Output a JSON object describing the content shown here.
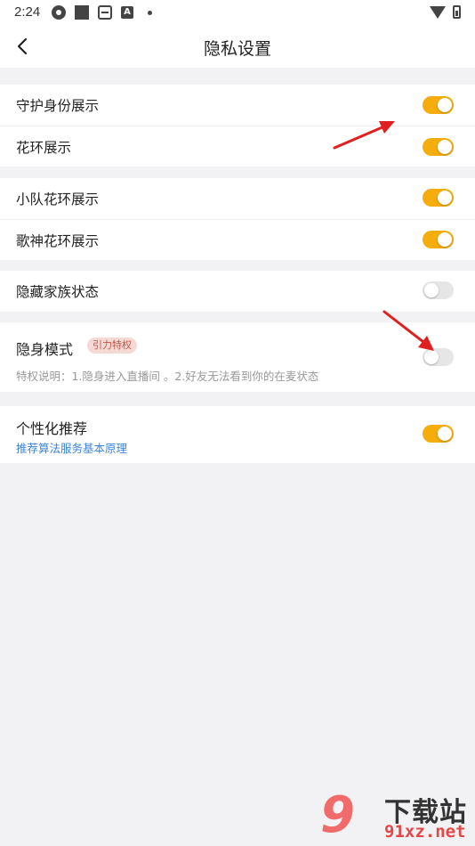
{
  "status_bar": {
    "time": "2:24"
  },
  "header": {
    "title": "隐私设置"
  },
  "groups": [
    {
      "items": [
        {
          "label": "守护身份展示",
          "enabled": true
        },
        {
          "label": "花环展示",
          "enabled": true
        }
      ]
    },
    {
      "items": [
        {
          "label": "小队花环展示",
          "enabled": true
        },
        {
          "label": "歌神花环展示",
          "enabled": true
        }
      ]
    },
    {
      "items": [
        {
          "label": "隐藏家族状态",
          "enabled": false
        }
      ]
    }
  ],
  "stealth": {
    "label": "隐身模式",
    "badge": "引力特权",
    "description": "特权说明：1.隐身进入直播间 。2.好友无法看到你的在麦状态",
    "enabled": false
  },
  "recommendation": {
    "label": "个性化推荐",
    "link": "推荐算法服务基本原理",
    "enabled": true
  },
  "watermark": {
    "logo": "9",
    "cn": "下载站",
    "site": "91xz.net"
  },
  "colors": {
    "toggle_on": "#f6ad0c",
    "toggle_off": "#e6e6e6",
    "link": "#3c86d9",
    "annotation_arrow": "#e02020"
  }
}
